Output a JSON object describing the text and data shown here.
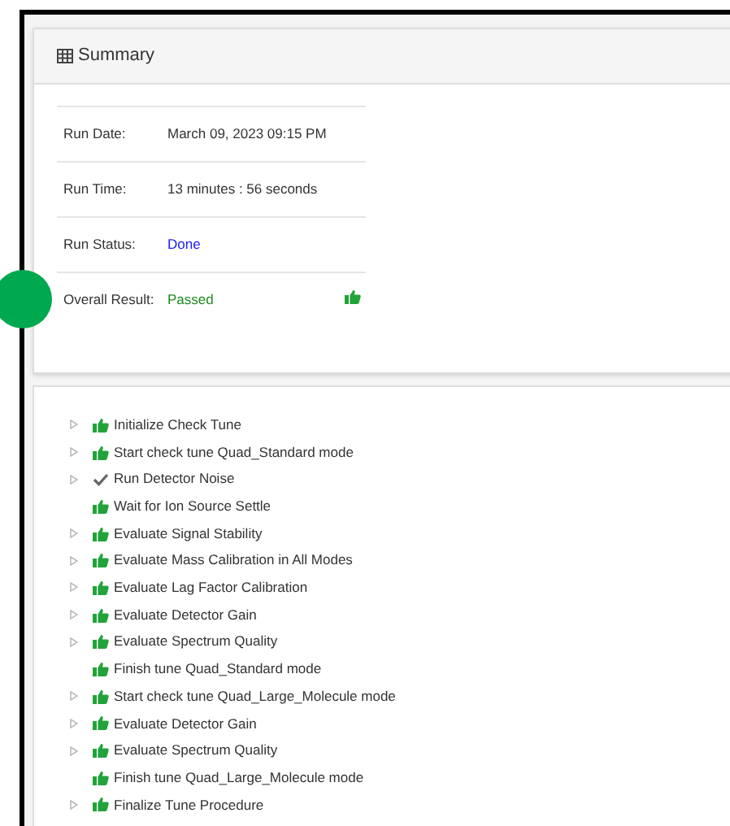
{
  "summary": {
    "title": "Summary",
    "fields": [
      {
        "label": "Run Date:",
        "value": "March 09, 2023 09:15 PM",
        "kind": "plain"
      },
      {
        "label": "Run Time:",
        "value": "13 minutes : 56 seconds",
        "kind": "plain"
      },
      {
        "label": "Run Status:",
        "value": "Done",
        "kind": "status"
      },
      {
        "label": "Overall Result:",
        "value": "Passed",
        "kind": "result"
      }
    ]
  },
  "steps": [
    {
      "label": "Initialize Check Tune",
      "expandable": true,
      "kind": "passed"
    },
    {
      "label": "Start check tune Quad_Standard mode",
      "expandable": true,
      "kind": "passed"
    },
    {
      "label": "Run Detector Noise",
      "expandable": true,
      "kind": "done"
    },
    {
      "label": "Wait for Ion Source Settle",
      "expandable": false,
      "kind": "passed"
    },
    {
      "label": "Evaluate Signal Stability",
      "expandable": true,
      "kind": "passed"
    },
    {
      "label": "Evaluate Mass Calibration in All Modes",
      "expandable": true,
      "kind": "passed"
    },
    {
      "label": "Evaluate Lag Factor Calibration",
      "expandable": true,
      "kind": "passed"
    },
    {
      "label": "Evaluate Detector Gain",
      "expandable": true,
      "kind": "passed"
    },
    {
      "label": "Evaluate Spectrum Quality",
      "expandable": true,
      "kind": "passed"
    },
    {
      "label": "Finish tune Quad_Standard mode",
      "expandable": false,
      "kind": "passed"
    },
    {
      "label": "Start check tune Quad_Large_Molecule mode",
      "expandable": true,
      "kind": "passed"
    },
    {
      "label": "Evaluate Detector Gain",
      "expandable": true,
      "kind": "passed"
    },
    {
      "label": "Evaluate Spectrum Quality",
      "expandable": true,
      "kind": "passed"
    },
    {
      "label": "Finish tune Quad_Large_Molecule mode",
      "expandable": false,
      "kind": "passed"
    },
    {
      "label": "Finalize Tune Procedure",
      "expandable": true,
      "kind": "passed"
    }
  ]
}
